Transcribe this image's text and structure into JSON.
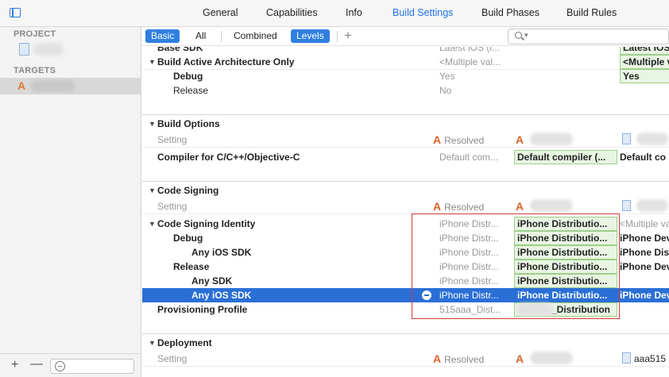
{
  "tabs": [
    "General",
    "Capabilities",
    "Info",
    "Build Settings",
    "Build Phases",
    "Build Rules"
  ],
  "active_tab": "Build Settings",
  "sidebar": {
    "project_header": "PROJECT",
    "targets_header": "TARGETS"
  },
  "filter": {
    "basic": "Basic",
    "all": "All",
    "combined": "Combined",
    "levels": "Levels"
  },
  "rows": {
    "base_sdk": {
      "name": "Base SDK",
      "c1": "Latest iOS (i...",
      "c3": "Latest iOS"
    },
    "baa": {
      "name": "Build Active Architecture Only",
      "c1": "<Multiple val...",
      "c3": "<Multiple v"
    },
    "baa_debug": {
      "name": "Debug",
      "c1": "Yes",
      "c3": "Yes"
    },
    "baa_release": {
      "name": "Release",
      "c1": "No"
    },
    "build_options": {
      "name": "Build Options"
    },
    "bo_setting": {
      "name": "Setting",
      "c1": "Resolved"
    },
    "compiler": {
      "name": "Compiler for C/C++/Objective-C",
      "c1": "Default com...",
      "c2": "Default compiler (...",
      "c3": "Default co"
    },
    "code_signing": {
      "name": "Code Signing"
    },
    "cs_setting": {
      "name": "Setting",
      "c1": "Resolved"
    },
    "csi": {
      "name": "Code Signing Identity",
      "c1": "iPhone Distr...",
      "c2": "iPhone Distributio...",
      "c3": "<Multiple va"
    },
    "csi_debug": {
      "name": "Debug",
      "c1": "iPhone Distr...",
      "c2": "iPhone Distributio...",
      "c3": "iPhone Dev"
    },
    "csi_debug_any_ios": {
      "name": "Any iOS SDK",
      "c1": "iPhone Distr...",
      "c2": "iPhone Distributio...",
      "c3": "iPhone Dis"
    },
    "csi_release": {
      "name": "Release",
      "c1": "iPhone Distr...",
      "c2": "iPhone Distributio...",
      "c3": "iPhone Dev"
    },
    "csi_release_any_sdk": {
      "name": "Any SDK",
      "c1": "iPhone Distr...",
      "c2": "iPhone Distributio..."
    },
    "csi_release_any_ios": {
      "name": "Any iOS SDK",
      "c1": "iPhone Distr...",
      "c2": "iPhone Distributio...",
      "c3": "iPhone Dev"
    },
    "prov_profile": {
      "name": "Provisioning Profile",
      "c1": "515aaa_Dist...",
      "c2": "_Distribution"
    },
    "deployment": {
      "name": "Deployment"
    },
    "dep_setting": {
      "name": "Setting",
      "c1": "Resolved",
      "c3": "aaa515"
    }
  }
}
